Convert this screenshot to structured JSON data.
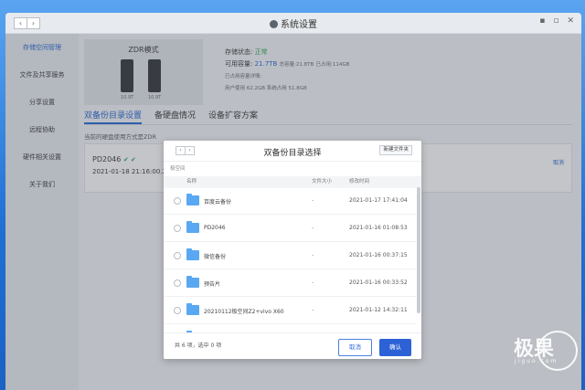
{
  "window": {
    "title": "系统设置",
    "nav_back": "‹",
    "nav_forward": "›",
    "controls": [
      "▪",
      "▫",
      "✕"
    ]
  },
  "sidebar": {
    "items": [
      {
        "label": "存储空间管理",
        "active": true
      },
      {
        "label": "文件及共享服务"
      },
      {
        "label": "分享设置"
      },
      {
        "label": "远程协助"
      },
      {
        "label": "硬件相关设置"
      },
      {
        "label": "关于我们"
      }
    ]
  },
  "nas": {
    "mode": "ZDR模式",
    "drive1_label": "10.9T",
    "drive2_label": "10.9T"
  },
  "storage": {
    "status_label": "存储状态:",
    "status_value": "正常",
    "capacity_label": "可用容量:",
    "capacity_value": "21.7TB",
    "total_label": "总容量:",
    "total_value": "21.8TB",
    "used_label": "已占用:",
    "used_value": "114GB",
    "detail_label": "已占用容量详情:",
    "user_used": "用户使用 62.2GB",
    "system_used": "系统占用 51.8GB"
  },
  "tabs": [
    "双备份目录设置",
    "备硬盘情况",
    "设备扩容方案"
  ],
  "note": "当前的硬盘使用方式是ZDR",
  "backup_entry": {
    "name": "PD2046",
    "check": "✔ ✔",
    "date": "2021-01-18 21:16:00.2",
    "cancel": "取消"
  },
  "dialog": {
    "title": "双备份目录选择",
    "nav_back": "‹",
    "nav_forward": "›",
    "new_folder": "新建文件夹",
    "breadcrumb": "极空间",
    "columns": {
      "name": "名称",
      "size": "文件大小",
      "mtime": "修改时间"
    },
    "rows": [
      {
        "name": "百度云备份",
        "size": "-",
        "mtime": "2021-01-17 17:41:04"
      },
      {
        "name": "PD2046",
        "size": "-",
        "mtime": "2021-01-16 01:08:53"
      },
      {
        "name": "微信备份",
        "size": "-",
        "mtime": "2021-01-16 00:37:15"
      },
      {
        "name": "预告片",
        "size": "-",
        "mtime": "2021-01-16 00:33:52"
      },
      {
        "name": "20210112极空间Z2+vivo X60",
        "size": "-",
        "mtime": "2021-01-12 14:32:11"
      },
      {
        "name": "",
        "size": "",
        "mtime": ""
      }
    ],
    "count_text": "共 6 项，选中 0 项",
    "cancel_label": "取消",
    "confirm_label": "确认"
  },
  "watermark": {
    "brand": "极果",
    "sub": "jiguo.com"
  }
}
